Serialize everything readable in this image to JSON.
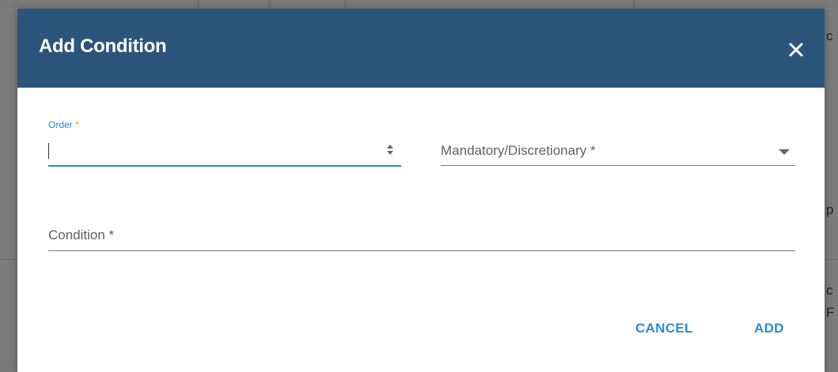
{
  "dialog": {
    "title": "Add Condition",
    "close_label": "×"
  },
  "form": {
    "order_label": "Order",
    "order_required_mark": "*",
    "order_value": "",
    "mandatory_label": "Mandatory/Discretionary *",
    "condition_label": "Condition *"
  },
  "actions": {
    "cancel_label": "CANCEL",
    "add_label": "ADD"
  },
  "background": {
    "fragments": [
      "c",
      "p",
      "c",
      "F"
    ]
  },
  "colors": {
    "header_bg": "#2c557c",
    "accent": "#1f8bd1",
    "required_mark": "#f39c12",
    "overlay": "#7b7b7b"
  }
}
